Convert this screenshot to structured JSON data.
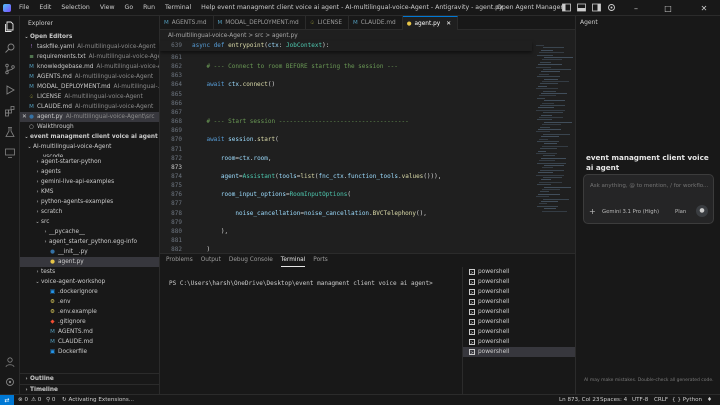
{
  "window": {
    "title": "event managment client voice ai agent - AI-multilingual-voice-Agent - Antigravity - agent.py",
    "menu": [
      "File",
      "Edit",
      "Selection",
      "View",
      "Go",
      "Run",
      "Terminal",
      "Help"
    ],
    "agent_manager": "Open Agent Manager"
  },
  "explorer": {
    "header": "Explorer",
    "open_editors_label": "Open Editors",
    "open_editors": [
      {
        "icon": "yaml",
        "name": "taskfile.yaml",
        "path": "AI-multilingual-voice-Agent",
        "color": "#a074c4"
      },
      {
        "icon": "txt",
        "name": "requirements.txt",
        "path": "AI-multilingual-voice-Agent",
        "color": "#89d185"
      },
      {
        "icon": "md",
        "name": "knowledgebase.md",
        "path": "AI-multilingual-voice-A...",
        "color": "#519aba"
      },
      {
        "icon": "md",
        "name": "AGENTS.md",
        "path": "AI-multilingual-voice-Agent",
        "color": "#519aba"
      },
      {
        "icon": "md",
        "name": "MODAL_DEPLOYMENT.md",
        "path": "AI-multilingual-...",
        "color": "#519aba"
      },
      {
        "icon": "lic",
        "name": "LICENSE",
        "path": "AI-multilingual-voice-Agent",
        "color": "#cbcb41"
      },
      {
        "icon": "md",
        "name": "CLAUDE.md",
        "path": "AI-multilingual-voice-Agent",
        "color": "#519aba"
      },
      {
        "icon": "py",
        "name": "agent.py",
        "path": "AI-multilingual-voice-Agent\\src",
        "color": "#3572a5"
      },
      {
        "icon": "walk",
        "name": "Walkthrough",
        "path": "",
        "color": "#cccccc"
      }
    ],
    "workspace_label": "event managment client voice ai agent",
    "tree": [
      {
        "indent": 1,
        "chev": "v",
        "name": "AI-multilingual-voice-Agent",
        "type": "folder"
      },
      {
        "indent": 2,
        "chev": "",
        "name": ".vscode",
        "type": "folder-cut"
      },
      {
        "indent": 2,
        "chev": ">",
        "name": "agent-starter-python",
        "type": "folder"
      },
      {
        "indent": 2,
        "chev": ">",
        "name": "agents",
        "type": "folder"
      },
      {
        "indent": 2,
        "chev": ">",
        "name": "gemini-live-api-examples",
        "type": "folder"
      },
      {
        "indent": 2,
        "chev": ">",
        "name": "KMS",
        "type": "folder"
      },
      {
        "indent": 2,
        "chev": ">",
        "name": "python-agents-examples",
        "type": "folder"
      },
      {
        "indent": 2,
        "chev": ">",
        "name": "scratch",
        "type": "folder"
      },
      {
        "indent": 2,
        "chev": "v",
        "name": "src",
        "type": "folder"
      },
      {
        "indent": 3,
        "chev": ">",
        "name": "__pycache__",
        "type": "folder"
      },
      {
        "indent": 3,
        "chev": ">",
        "name": "agent_starter_python.egg-info",
        "type": "folder"
      },
      {
        "indent": 3,
        "chev": "",
        "name": "__init__.py",
        "type": "py"
      },
      {
        "indent": 3,
        "chev": "",
        "name": "agent.py",
        "type": "py-active"
      },
      {
        "indent": 2,
        "chev": ">",
        "name": "tests",
        "type": "folder"
      },
      {
        "indent": 2,
        "chev": "v",
        "name": "voice-agent-workshop",
        "type": "folder"
      },
      {
        "indent": 3,
        "chev": "",
        "name": ".dockerignore",
        "type": "docker"
      },
      {
        "indent": 3,
        "chev": "",
        "name": ".env",
        "type": "env"
      },
      {
        "indent": 3,
        "chev": "",
        "name": ".env.example",
        "type": "env"
      },
      {
        "indent": 3,
        "chev": "",
        "name": ".gitignore",
        "type": "git"
      },
      {
        "indent": 3,
        "chev": "",
        "name": "AGENTS.md",
        "type": "md"
      },
      {
        "indent": 3,
        "chev": "",
        "name": "CLAUDE.md",
        "type": "md"
      },
      {
        "indent": 3,
        "chev": "",
        "name": "Dockerfile",
        "type": "docker"
      }
    ],
    "outline_label": "Outline",
    "timeline_label": "Timeline"
  },
  "tabs": [
    {
      "icon": "md",
      "label": "AGENTS.md",
      "active": false
    },
    {
      "icon": "md",
      "label": "MODAL_DEPLOYMENT.md",
      "active": false
    },
    {
      "icon": "lic",
      "label": "LICENSE",
      "active": false
    },
    {
      "icon": "md",
      "label": "CLAUDE.md",
      "active": false
    },
    {
      "icon": "py",
      "label": "agent.py",
      "active": true
    }
  ],
  "breadcrumb": "AI-multilingual-voice-Agent  >  src  >  agent.py",
  "editor": {
    "sticky": {
      "ln": "639",
      "code": "async def entrypoint(ctx: JobContext):"
    },
    "lines": [
      {
        "ln": "861",
        "code": ""
      },
      {
        "ln": "862",
        "code": "    # --- Connect to room BEFORE starting the session ---"
      },
      {
        "ln": "863",
        "code": ""
      },
      {
        "ln": "864",
        "code": "    await ctx.connect()"
      },
      {
        "ln": "865",
        "code": ""
      },
      {
        "ln": "866",
        "code": ""
      },
      {
        "ln": "867",
        "code": ""
      },
      {
        "ln": "868",
        "code": "    # --- Start session ------------------------------------"
      },
      {
        "ln": "869",
        "code": ""
      },
      {
        "ln": "870",
        "code": "    await session.start("
      },
      {
        "ln": "871",
        "code": ""
      },
      {
        "ln": "872",
        "code": "        room=ctx.room,"
      },
      {
        "ln": "873",
        "code": ""
      },
      {
        "ln": "874",
        "code": "        agent=Assistant(tools=list(fnc_ctx.function_tools.values())),"
      },
      {
        "ln": "875",
        "code": ""
      },
      {
        "ln": "876",
        "code": "        room_input_options=RoomInputOptions("
      },
      {
        "ln": "877",
        "code": ""
      },
      {
        "ln": "878",
        "code": "            noise_cancellation=noise_cancellation.BVCTelephony(),"
      },
      {
        "ln": "879",
        "code": ""
      },
      {
        "ln": "880",
        "code": "        ),"
      },
      {
        "ln": "881",
        "code": ""
      },
      {
        "ln": "882",
        "code": "    )"
      }
    ]
  },
  "panel": {
    "tabs": [
      "Problems",
      "Output",
      "Debug Console",
      "Terminal",
      "Ports"
    ],
    "active_tab": "Terminal",
    "terminal_prompt": "PS C:\\Users\\harsh\\OneDrive\\Desktop\\event managment client voice ai agent>",
    "terminals": [
      "powershell",
      "powershell",
      "powershell",
      "powershell",
      "powershell",
      "powershell",
      "powershell",
      "powershell",
      "powershell"
    ]
  },
  "agent_panel": {
    "header": "Agent",
    "title": "event managment client voice ai agent",
    "input_placeholder": "Ask anything, @ to mention, / for workflo...",
    "model": "Gemini 3.1 Pro (High)",
    "mode": "Plan",
    "footer": "AI may make mistakes. Double-check all generated code."
  },
  "statusbar": {
    "errors": "0",
    "warnings": "0",
    "ports": "0",
    "activity": "Activating Extensions...",
    "position": "Ln 873, Col 23",
    "spaces": "Spaces: 4",
    "encoding": "UTF-8",
    "eol": "CRLF",
    "language": "Python"
  },
  "colors": {
    "accent": "#0078d4",
    "background": "#1f1f1f",
    "sidebar": "#181818"
  }
}
